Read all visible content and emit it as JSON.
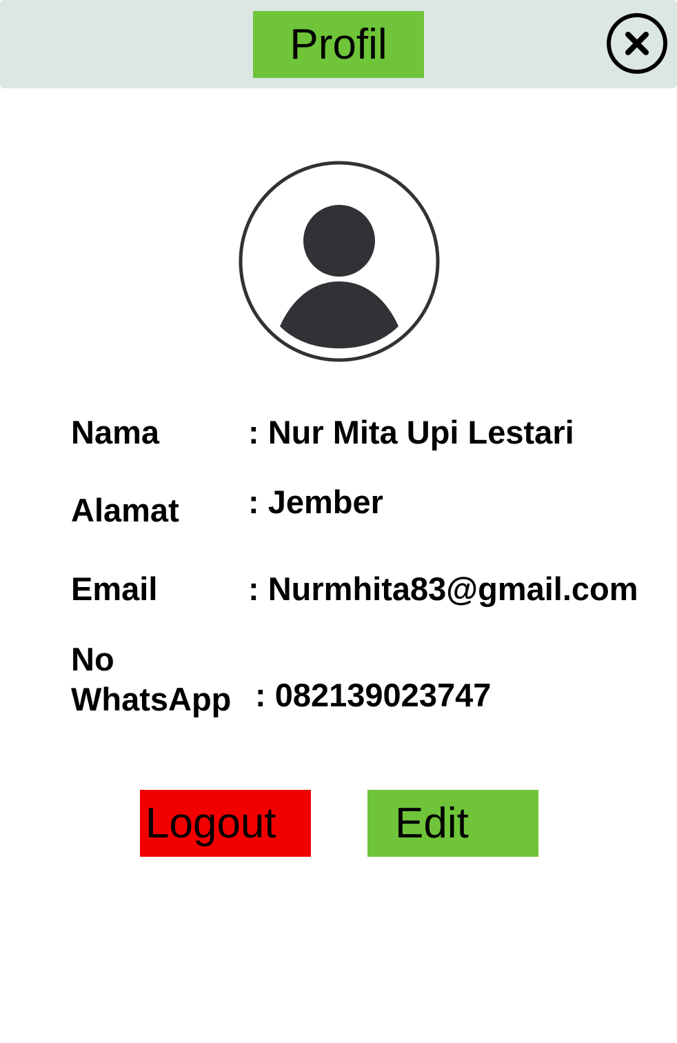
{
  "header": {
    "title": "Profil",
    "close_icon": "close-circle-icon"
  },
  "avatar": {
    "icon": "user-avatar-icon"
  },
  "profile": {
    "nama_label": "Nama",
    "nama_value": ": Nur Mita Upi Lestari",
    "alamat_label": "Alamat",
    "alamat_value": ": Jember",
    "email_label": "Email",
    "email_value": ": Nurmhita83@gmail.com",
    "whatsapp_label_line1": "No",
    "whatsapp_label_line2": "WhatsApp",
    "whatsapp_value": ": 082139023747"
  },
  "actions": {
    "logout_label": "Logout",
    "edit_label": "Edit"
  },
  "colors": {
    "header_bg": "#dce6e3",
    "accent_green": "#6fc43a",
    "logout_red": "#f20000",
    "icon_dark": "#303235"
  }
}
